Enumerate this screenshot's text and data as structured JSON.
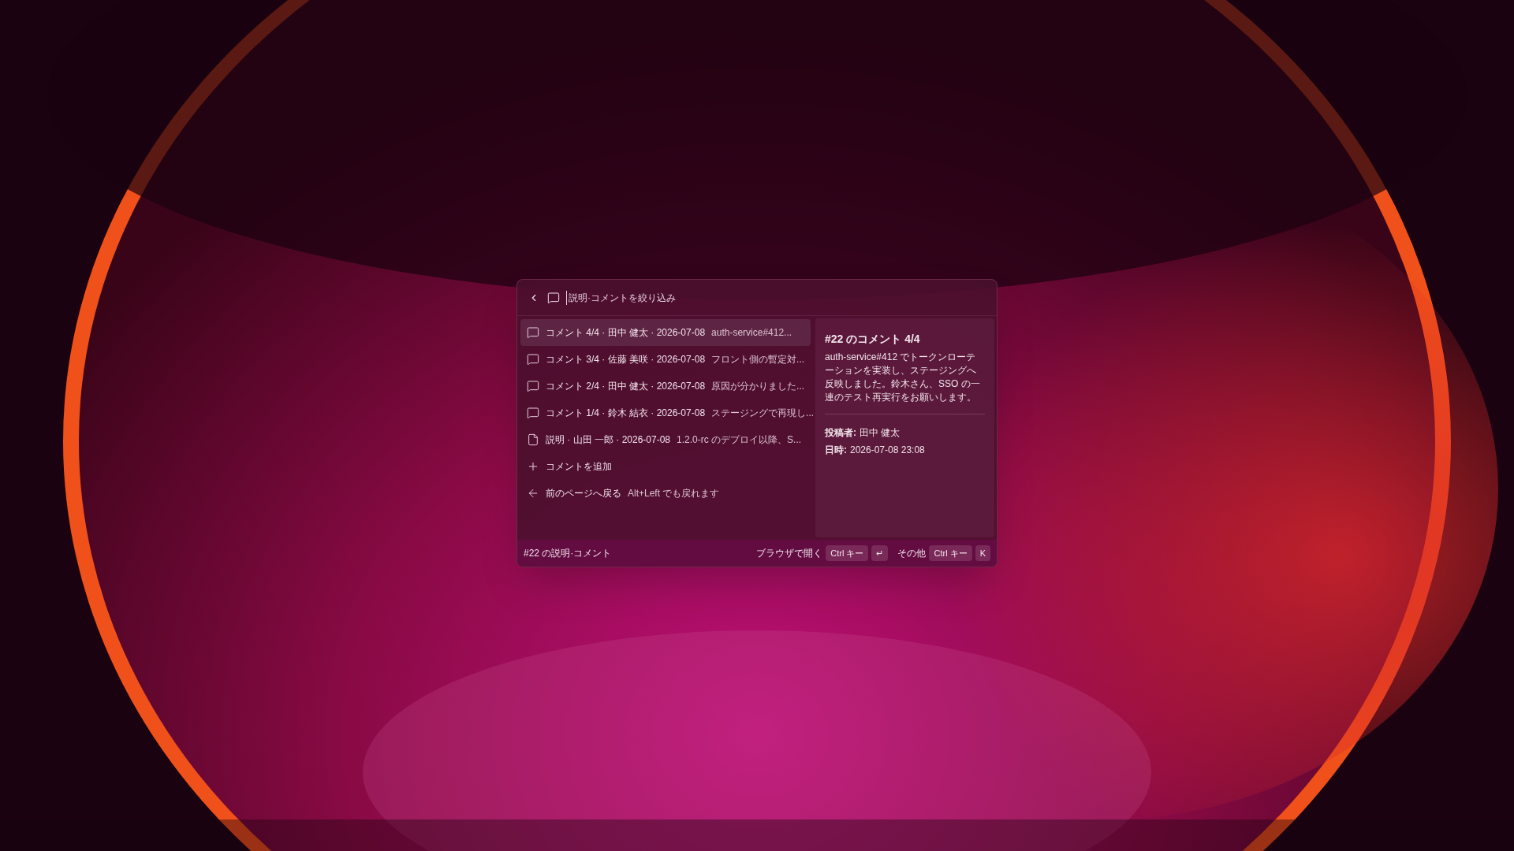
{
  "search": {
    "placeholder": "説明·コメントを絞り込み"
  },
  "items": [
    {
      "kind": "comment",
      "title": "コメント 4/4 · 田中 健太 · 2026-07-08",
      "preview": "auth-service#412...",
      "selected": true
    },
    {
      "kind": "comment",
      "title": "コメント 3/4 · 佐藤 美咲 · 2026-07-08",
      "preview": "フロント側の暫定対...",
      "selected": false
    },
    {
      "kind": "comment",
      "title": "コメント 2/4 · 田中 健太 · 2026-07-08",
      "preview": "原因が分かりました...",
      "selected": false
    },
    {
      "kind": "comment",
      "title": "コメント 1/4 · 鈴木 結衣 · 2026-07-08",
      "preview": "ステージングで再現し...",
      "selected": false
    },
    {
      "kind": "description",
      "title": "説明 · 山田 一郎 · 2026-07-08",
      "preview": "1.2.0-rc のデプロイ以降、S...",
      "selected": false
    },
    {
      "kind": "add",
      "title": "コメントを追加",
      "selected": false
    },
    {
      "kind": "back",
      "title": "前のページへ戻る",
      "preview": "Alt+Left でも戻れます",
      "selected": false
    }
  ],
  "detail": {
    "title": "#22 のコメント 4/4",
    "body": "auth-service#412 でトークンローテーションを実装し、ステージングへ反映しました。鈴木さん、SSO の一連のテスト再実行をお願いします。",
    "fields": [
      {
        "label": "投稿者:",
        "value": "田中 健太"
      },
      {
        "label": "日時:",
        "value": "2026-07-08 23:08"
      }
    ]
  },
  "footer": {
    "context": "#22 の説明·コメント",
    "actions": [
      {
        "label": "ブラウザで開く",
        "keys": [
          "Ctrl キー",
          "↵"
        ]
      },
      {
        "label": "その他",
        "keys": [
          "Ctrl キー",
          "K"
        ]
      }
    ]
  }
}
